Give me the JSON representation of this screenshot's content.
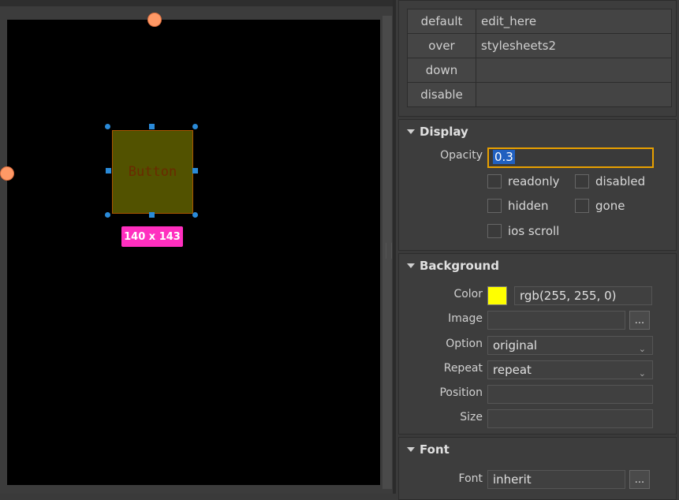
{
  "canvas": {
    "widget_label": "Button",
    "size_badge": "140 x 143"
  },
  "states": [
    {
      "key": "default",
      "value": "edit_here"
    },
    {
      "key": "over",
      "value": "stylesheets2"
    },
    {
      "key": "down",
      "value": ""
    },
    {
      "key": "disable",
      "value": ""
    }
  ],
  "display": {
    "title": "Display",
    "opacity_label": "Opacity",
    "opacity_value": "0.3",
    "checkboxes": {
      "readonly": "readonly",
      "disabled": "disabled",
      "hidden": "hidden",
      "gone": "gone",
      "ios_scroll": "ios scroll"
    }
  },
  "background": {
    "title": "Background",
    "color_label": "Color",
    "color_value": "rgb(255, 255, 0)",
    "swatch_color": "#ffff00",
    "image_label": "Image",
    "image_value": "",
    "image_button": "...",
    "option_label": "Option",
    "option_value": "original",
    "repeat_label": "Repeat",
    "repeat_value": "repeat",
    "position_label": "Position",
    "position_value": "",
    "size_label": "Size",
    "size_value": ""
  },
  "font": {
    "title": "Font",
    "font_label": "Font",
    "font_value": "inherit",
    "font_button": "..."
  },
  "colors": {
    "accent_focus": "#e8a000",
    "selection_handle": "#2a8ad8",
    "size_badge": "#ff2fbf",
    "guide_handle": "#ff9966"
  }
}
